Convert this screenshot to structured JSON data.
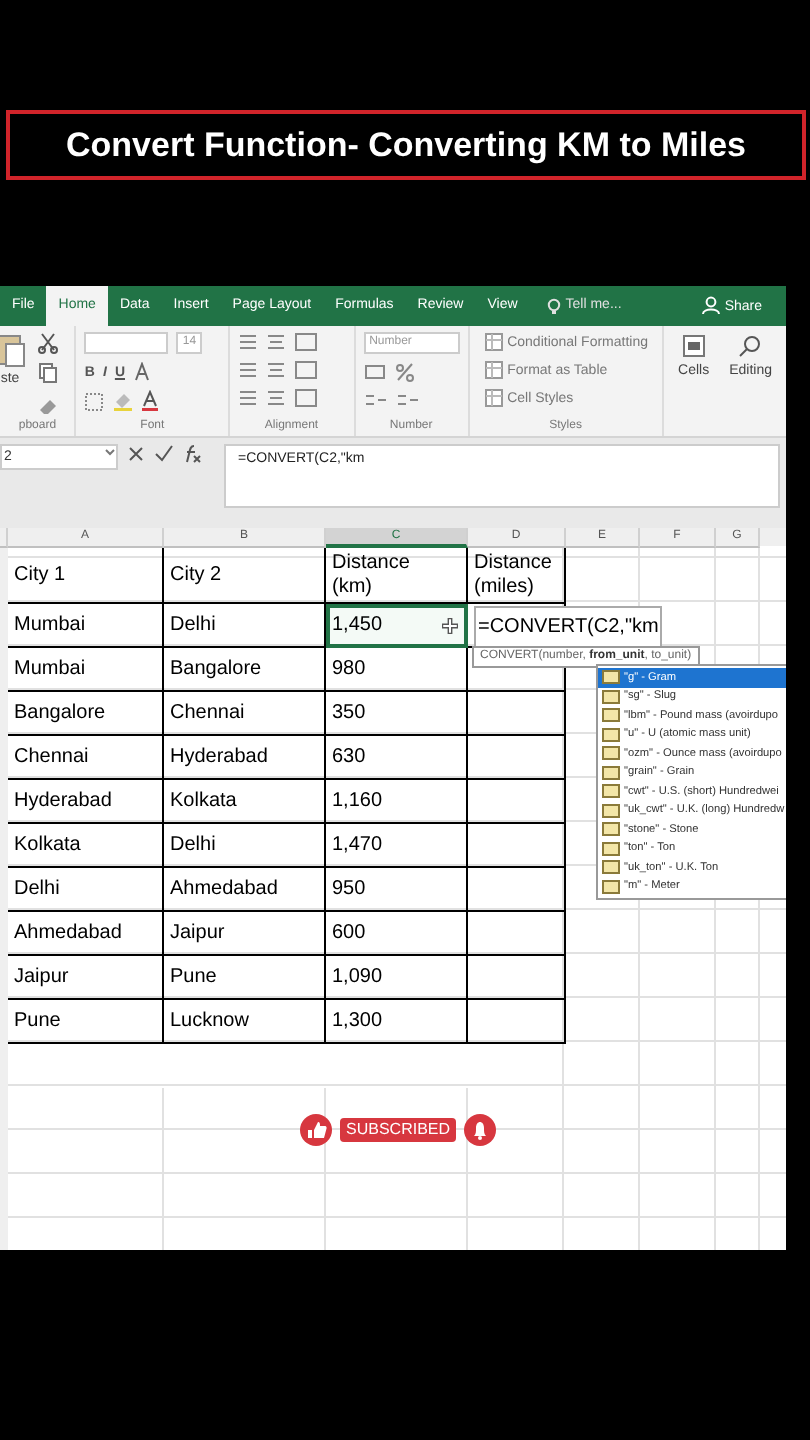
{
  "title": "Convert Function- Converting KM to Miles",
  "ribbon": {
    "tabs": [
      {
        "label": "File",
        "selected": false
      },
      {
        "label": "Home",
        "selected": true
      },
      {
        "label": "Data",
        "selected": false
      },
      {
        "label": "Insert",
        "selected": false
      },
      {
        "label": "Page Layout",
        "selected": false
      },
      {
        "label": "Formulas",
        "selected": false
      },
      {
        "label": "Review",
        "selected": false
      },
      {
        "label": "View",
        "selected": false
      }
    ],
    "tell_me": "Tell me...",
    "share": "Share",
    "paste_label": "ste",
    "font_size": "14",
    "font_buttons": [
      "B",
      "I",
      "U"
    ],
    "number_format": "Number",
    "style_items": [
      "Conditional Formatting",
      "Format as Table",
      "Cell Styles"
    ],
    "cells_label": "Cells",
    "editing_label": "Editing",
    "group_labels": [
      "pboard",
      "Font",
      "Alignment",
      "Number",
      "Styles"
    ]
  },
  "formula_bar": {
    "name_box": "2",
    "formula": "=CONVERT(C2,\"km"
  },
  "sheet": {
    "columns": [
      "A",
      "B",
      "C",
      "D",
      "E",
      "F",
      "G"
    ],
    "rows": [
      {
        "cells": [
          {
            "text": "City 1",
            "selected": false,
            "kind": "text"
          },
          {
            "text": "City 2",
            "selected": false,
            "kind": "text"
          },
          {
            "text": "Distance\n(km)",
            "selected": false,
            "kind": "text"
          },
          {
            "text": "Distance\n(miles)",
            "selected": false,
            "kind": "text"
          }
        ]
      },
      {
        "cells": [
          {
            "text": "Mumbai",
            "selected": false,
            "kind": "text"
          },
          {
            "text": "Delhi",
            "selected": false,
            "kind": "text"
          },
          {
            "text": "1,450",
            "selected": true,
            "kind": "text"
          },
          {
            "text": "=CONVERT(C2,\"km",
            "selected": false,
            "kind": "editor"
          }
        ]
      },
      {
        "cells": [
          {
            "text": "Mumbai",
            "selected": false,
            "kind": "text"
          },
          {
            "text": "Bangalore",
            "selected": false,
            "kind": "text"
          },
          {
            "text": "980",
            "selected": false,
            "kind": "text"
          }
        ]
      },
      {
        "cells": [
          {
            "text": "Bangalore",
            "selected": false,
            "kind": "text"
          },
          {
            "text": "Chennai",
            "selected": false,
            "kind": "text"
          },
          {
            "text": "350",
            "selected": false,
            "kind": "text"
          }
        ]
      },
      {
        "cells": [
          {
            "text": "Chennai",
            "selected": false,
            "kind": "text"
          },
          {
            "text": "Hyderabad",
            "selected": false,
            "kind": "text"
          },
          {
            "text": "630",
            "selected": false,
            "kind": "text"
          }
        ]
      },
      {
        "cells": [
          {
            "text": "Hyderabad",
            "selected": false,
            "kind": "text"
          },
          {
            "text": "Kolkata",
            "selected": false,
            "kind": "text"
          },
          {
            "text": "1,160",
            "selected": false,
            "kind": "text"
          }
        ]
      },
      {
        "cells": [
          {
            "text": "Kolkata",
            "selected": false,
            "kind": "text"
          },
          {
            "text": "Delhi",
            "selected": false,
            "kind": "text"
          },
          {
            "text": "1,470",
            "selected": false,
            "kind": "text"
          }
        ]
      },
      {
        "cells": [
          {
            "text": "Delhi",
            "selected": false,
            "kind": "text"
          },
          {
            "text": "Ahmedabad",
            "selected": false,
            "kind": "text"
          },
          {
            "text": "950",
            "selected": false,
            "kind": "text"
          }
        ]
      },
      {
        "cells": [
          {
            "text": "Ahmedabad",
            "selected": false,
            "kind": "text"
          },
          {
            "text": "Jaipur",
            "selected": false,
            "kind": "text"
          },
          {
            "text": "600",
            "selected": false,
            "kind": "text"
          }
        ]
      },
      {
        "cells": [
          {
            "text": "Jaipur",
            "selected": false,
            "kind": "text"
          },
          {
            "text": "Pune",
            "selected": false,
            "kind": "text"
          },
          {
            "text": "1,090",
            "selected": false,
            "kind": "text"
          }
        ]
      },
      {
        "cells": [
          {
            "text": "Pune",
            "selected": false,
            "kind": "text"
          },
          {
            "text": "Lucknow",
            "selected": false,
            "kind": "text"
          },
          {
            "text": "1,300",
            "selected": false,
            "kind": "text"
          }
        ]
      }
    ]
  },
  "autocomplete": {
    "hint": "CONVERT(number, **from_unit**, to_unit)",
    "items": [
      {
        "label": "\"g\" - Gram",
        "selected": true
      },
      {
        "label": "\"sg\" - Slug",
        "selected": false
      },
      {
        "label": "\"lbm\" - Pound mass (avoirdupo",
        "selected": false
      },
      {
        "label": "\"u\" - U (atomic mass unit)",
        "selected": false
      },
      {
        "label": "\"ozm\" - Ounce mass (avoirdupo",
        "selected": false
      },
      {
        "label": "\"grain\" - Grain",
        "selected": false
      },
      {
        "label": "\"cwt\" - U.S. (short) Hundredwei",
        "selected": false
      },
      {
        "label": "\"uk_cwt\" - U.K. (long) Hundredw",
        "selected": false
      },
      {
        "label": "\"stone\" - Stone",
        "selected": false
      },
      {
        "label": "\"ton\" - Ton",
        "selected": false
      },
      {
        "label": "\"uk_ton\" - U.K. Ton",
        "selected": false
      },
      {
        "label": "\"m\" - Meter",
        "selected": false
      }
    ]
  },
  "subscribe": {
    "label": "SUBSCRIBED"
  }
}
